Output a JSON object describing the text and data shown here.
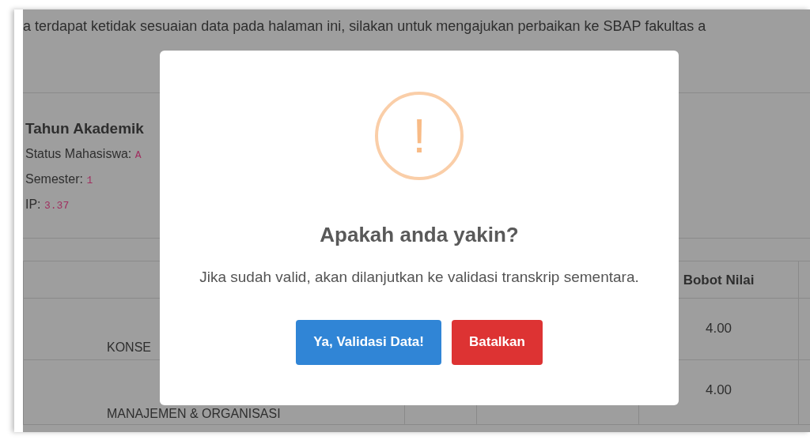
{
  "page": {
    "notice": "a terdapat ketidak sesuaian data pada halaman ini, silakan untuk mengajukan perbaikan ke SBAP fakultas a",
    "heading": "Tahun Akademik",
    "details": [
      {
        "label": "Status Mahasiswa:",
        "value": "A"
      },
      {
        "label": "Semester:",
        "value": "1"
      },
      {
        "label": "IP:",
        "value": "3.37"
      }
    ],
    "table": {
      "header": {
        "column_4": "Bobot Nilai"
      },
      "rows": [
        {
          "column_1": "KONSE",
          "column_4": "4.00"
        },
        {
          "column_1": "MANAJEMEN & ORGANISASI",
          "column_4": "4.00"
        }
      ]
    }
  },
  "dialog": {
    "icon": "!",
    "title": "Apakah anda yakin?",
    "text": "Jika sudah valid, akan dilanjutkan ke validasi transkrip sementara.",
    "buttons": [
      {
        "label": "Ya, Validasi Data!",
        "kind": "confirm"
      },
      {
        "label": "Batalkan",
        "kind": "cancel"
      }
    ]
  }
}
